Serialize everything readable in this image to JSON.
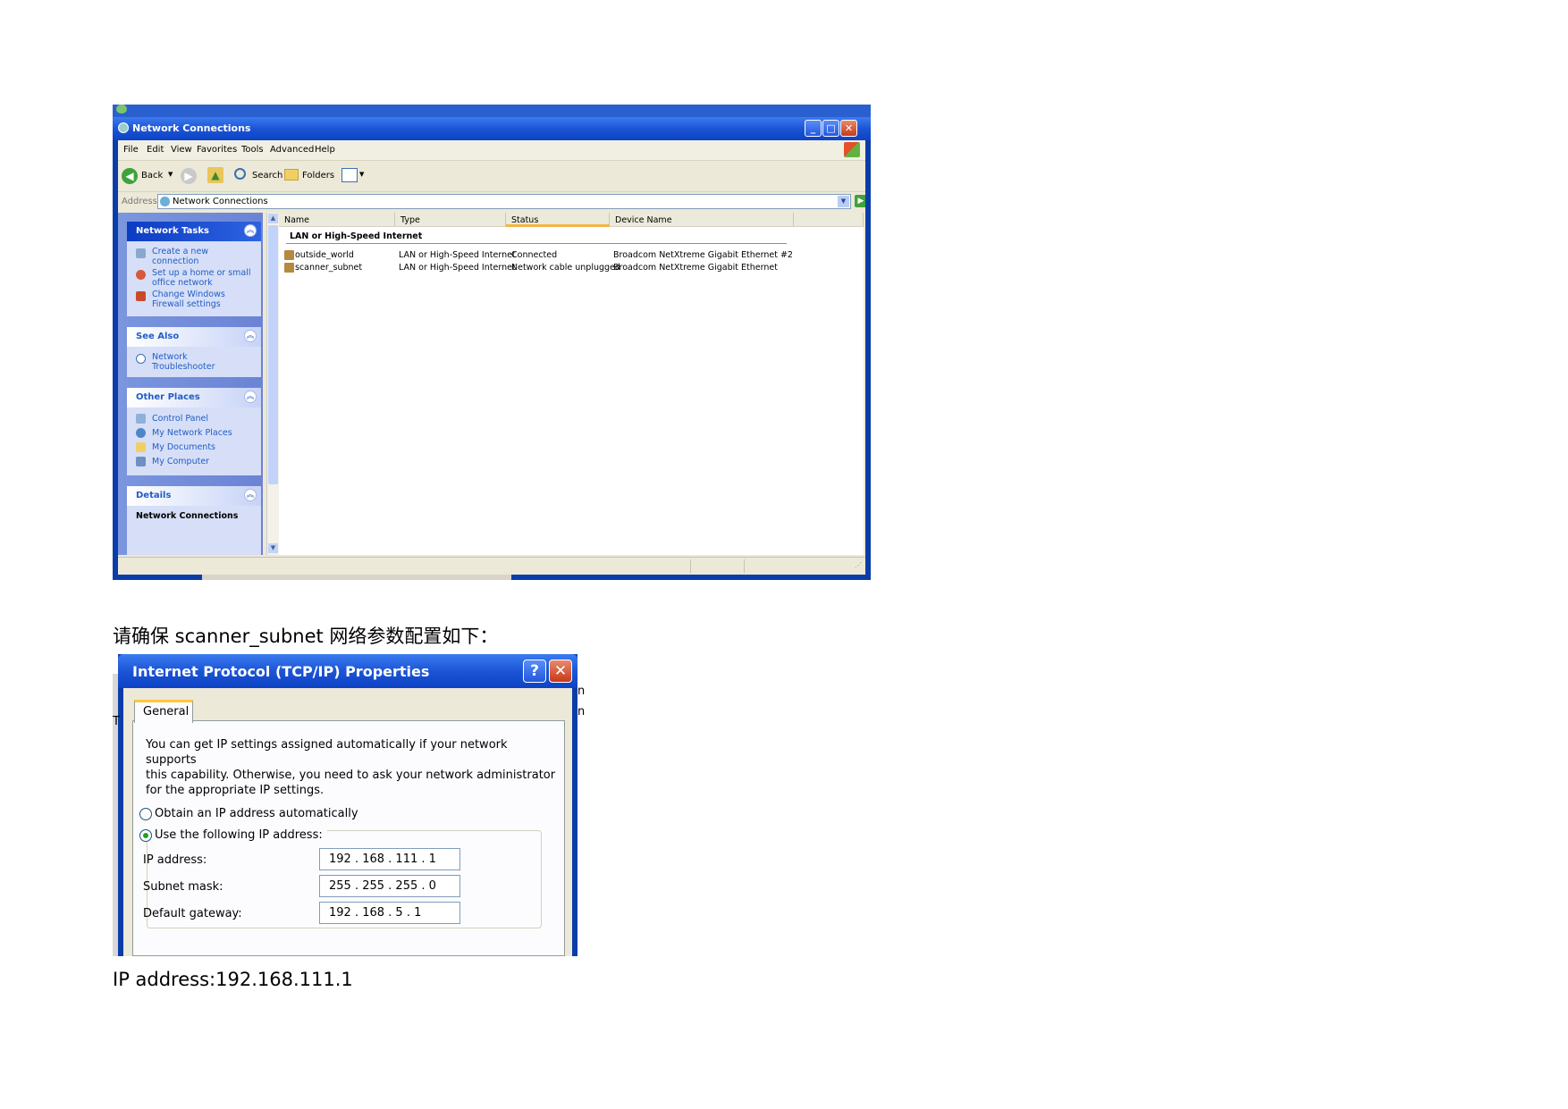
{
  "network_window": {
    "title": "Network Connections",
    "menu": [
      "File",
      "Edit",
      "View",
      "Favorites",
      "Tools",
      "Advanced",
      "Help"
    ],
    "toolbar": {
      "back": "Back",
      "search": "Search",
      "folders": "Folders"
    },
    "address": {
      "label": "Address",
      "value": "Network Connections",
      "go": "Go"
    },
    "network_tasks": {
      "title": "Network Tasks",
      "items": [
        {
          "line1": "Create a new",
          "line2": "connection"
        },
        {
          "line1": "Set up a home or small",
          "line2": "office network"
        },
        {
          "line1": "Change Windows",
          "line2": "Firewall settings"
        }
      ]
    },
    "see_also": {
      "title": "See Also",
      "items": [
        {
          "line1": "Network",
          "line2": "Troubleshooter"
        }
      ]
    },
    "other_places": {
      "title": "Other Places",
      "items": [
        "Control Panel",
        "My Network Places",
        "My Documents",
        "My Computer"
      ]
    },
    "details": {
      "title": "Details",
      "subtitle": "Network Connections"
    },
    "columns": [
      "Name",
      "Type",
      "Status",
      "Device Name"
    ],
    "group_heading": "LAN or High-Speed Internet",
    "rows": [
      {
        "name": "outside_world",
        "type": "LAN or High-Speed Internet",
        "status": "Connected",
        "device": "Broadcom NetXtreme Gigabit Ethernet #2"
      },
      {
        "name": "scanner_subnet",
        "type": "LAN or High-Speed Internet",
        "status": "Network cable unplugged",
        "device": "Broadcom NetXtreme Gigabit Ethernet"
      }
    ]
  },
  "caption_top": "请确保 scanner_subnet 网络参数配置如下：",
  "tcp_dialog": {
    "title": "Internet Protocol (TCP/IP) Properties",
    "help_glyph": "?",
    "close_glyph": "✕",
    "tab": "General",
    "description": [
      "You can get IP settings assigned automatically if your network supports",
      "this capability. Otherwise, you need to ask your network administrator",
      "for the appropriate IP settings."
    ],
    "radio_auto": "Obtain an IP address automatically",
    "radio_manual": "Use the following IP address:",
    "ip_label": "IP address:",
    "ip_value": "192 . 168 . 111 .  1",
    "mask_label": "Subnet mask:",
    "mask_value": "255 . 255 . 255 .  0",
    "gateway_label": "Default gateway:",
    "gateway_value": "192 . 168 .  5  .  1",
    "bleed_letters": [
      "n",
      "n",
      "T"
    ]
  },
  "caption_bottom": "IP address:192.168.111.1",
  "colors": {
    "xp_blue": "#0a3da8",
    "title_blue": "#1c54d6",
    "link_blue": "#215dc6",
    "face": "#ece9d8"
  }
}
